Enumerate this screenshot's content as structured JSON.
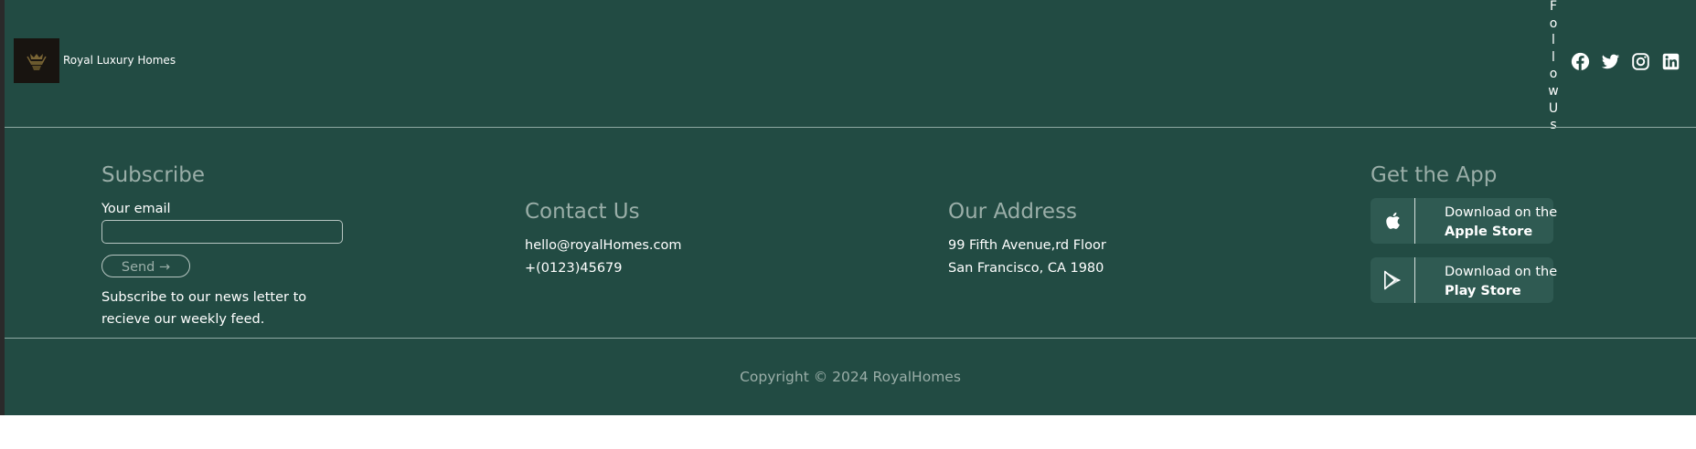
{
  "brand": {
    "name": "Royal Luxury Homes",
    "logo_icon": "crown-emblem-icon"
  },
  "follow": {
    "label": "FollowUs",
    "letters": [
      "F",
      "o",
      "l",
      "l",
      "o",
      "w",
      "U",
      "s"
    ]
  },
  "socials": [
    {
      "name": "facebook-icon"
    },
    {
      "name": "twitter-icon"
    },
    {
      "name": "instagram-icon"
    },
    {
      "name": "linkedin-icon"
    }
  ],
  "subscribe": {
    "title": "Subscribe",
    "email_label": "Your email",
    "email_value": "",
    "email_placeholder": "",
    "send_label": "Send →",
    "description": "Subscribe to our news letter to recieve our weekly feed."
  },
  "contact": {
    "title": "Contact Us",
    "email": "hello@royalHomes.com",
    "phone": "+(0123)45679"
  },
  "address": {
    "title": "Our Address",
    "line1": "99 Fifth Avenue,rd Floor",
    "line2": "San Francisco, CA 1980"
  },
  "app": {
    "title": "Get the App",
    "apple": {
      "line1": "Download on the",
      "line2": "Apple Store",
      "icon": "apple-icon"
    },
    "play": {
      "line1": "Download on the",
      "line2": "Play Store",
      "icon": "play-store-icon"
    }
  },
  "copyright": "Copyright © 2024 RoyalHomes",
  "colors": {
    "footer_bg": "#224b43",
    "muted_text": "#9aaea8",
    "store_bg": "#2f5a52"
  }
}
